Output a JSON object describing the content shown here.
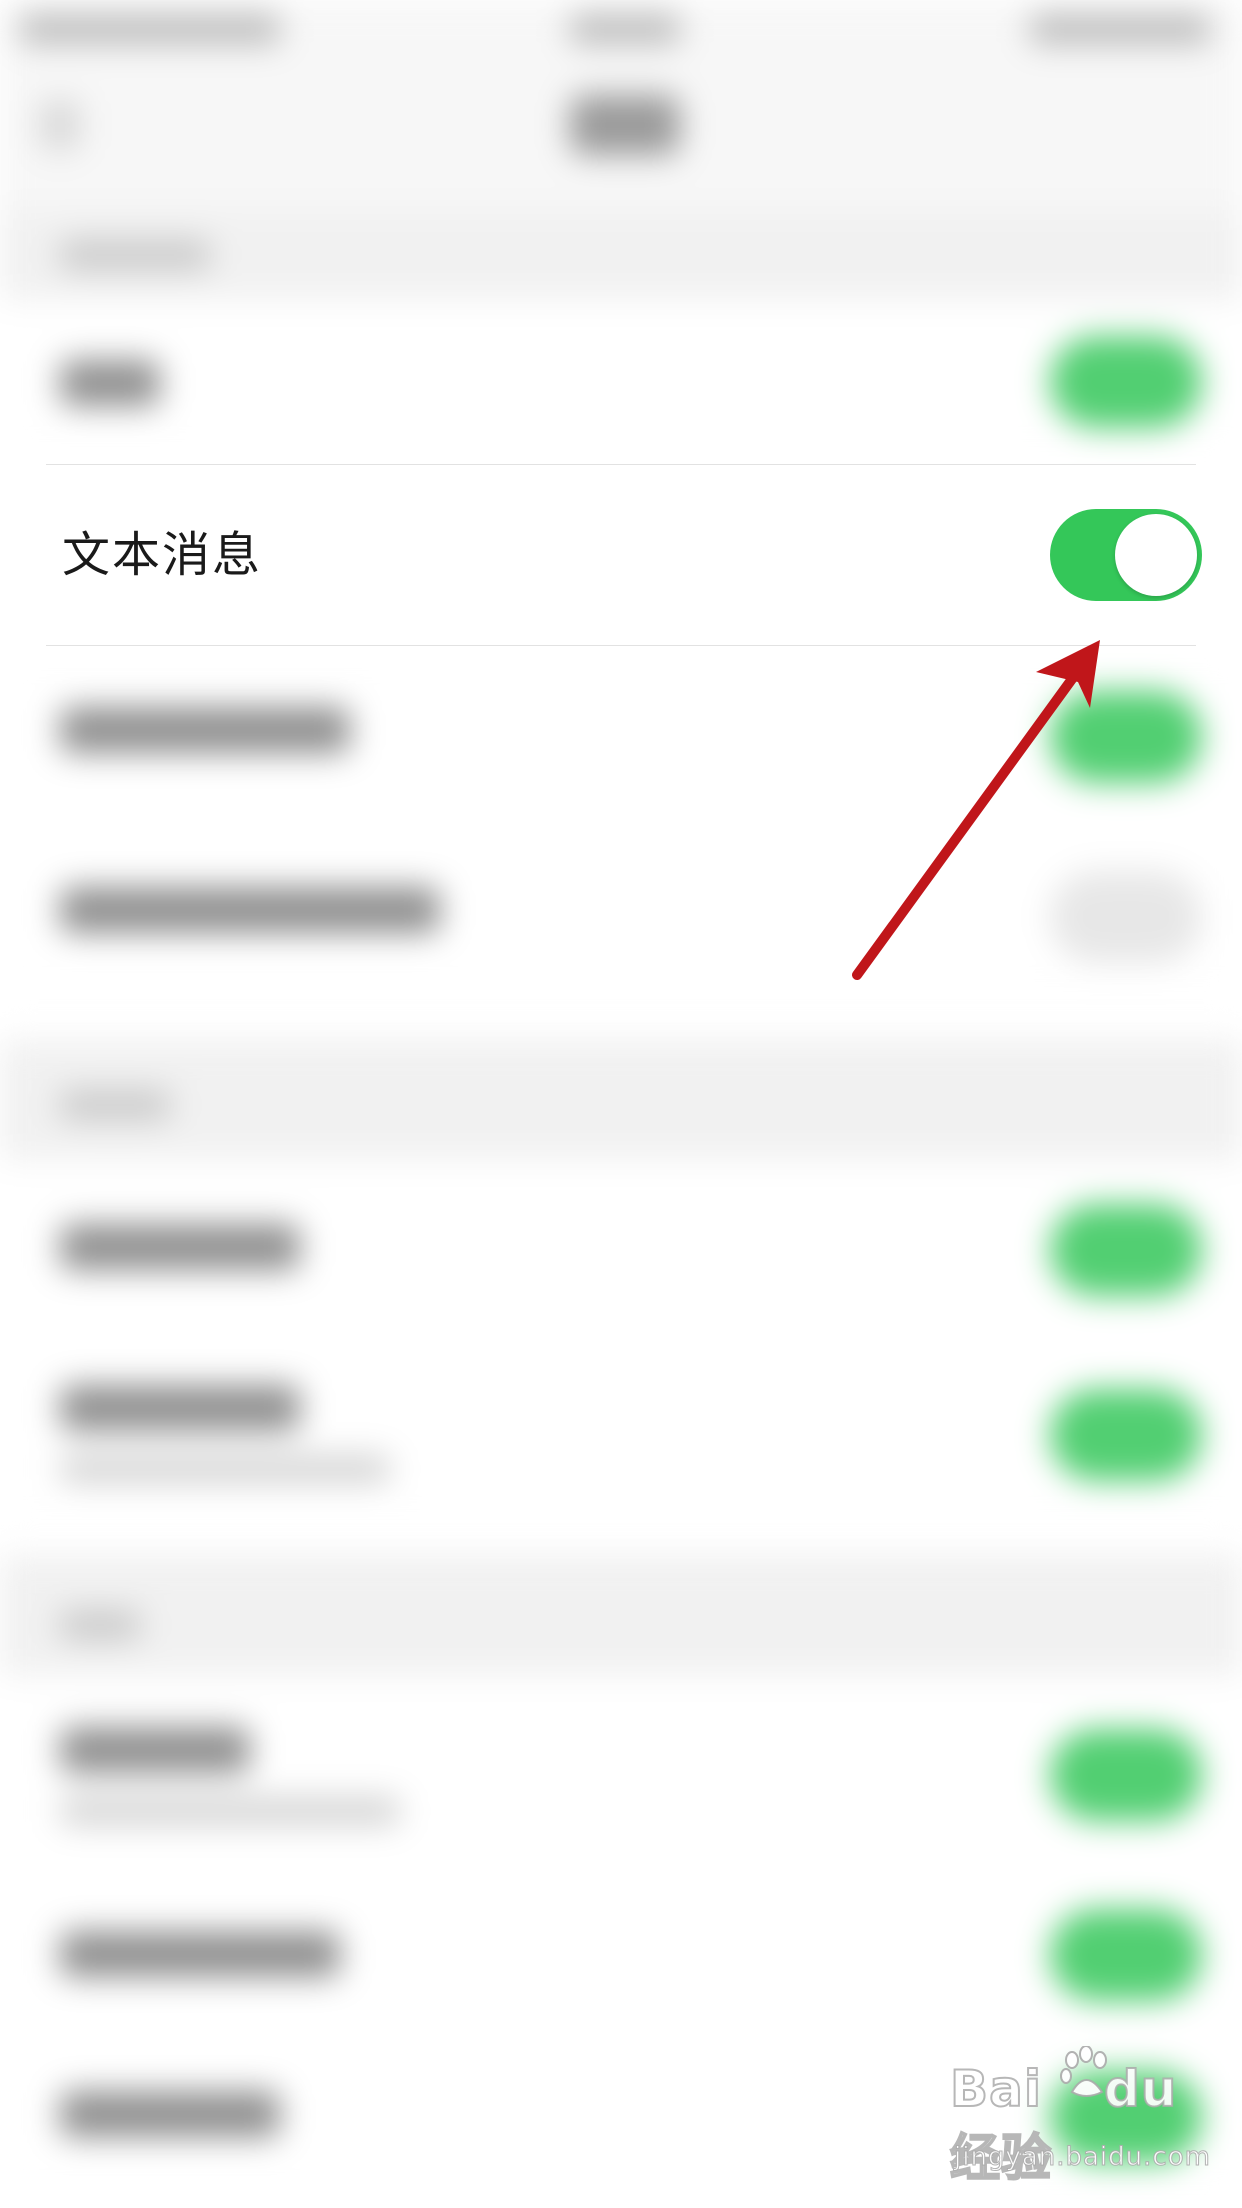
{
  "focused_setting": {
    "label": "文本消息",
    "toggle_on": true
  },
  "colors": {
    "toggle_on": "#34c759",
    "arrow": "#c0161a",
    "background": "#ffffff",
    "section_background": "#f1f1f1"
  },
  "watermark": {
    "brand_left": "Bai",
    "brand_right": "du经验",
    "url": "jingyan.baidu.com"
  }
}
